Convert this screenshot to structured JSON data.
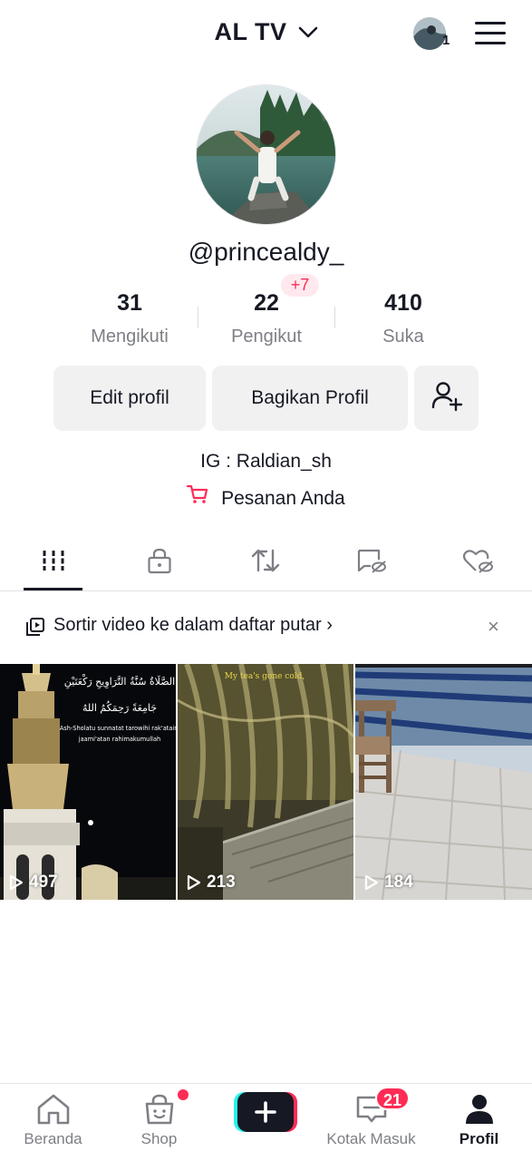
{
  "header": {
    "account_name": "AL TV",
    "switch_badge": "1",
    "icons": {
      "chevron": "chevron-down-icon",
      "menu": "hamburger-menu-icon"
    }
  },
  "profile": {
    "username": "@princealdy_",
    "stats": [
      {
        "value": "31",
        "label": "Mengikuti"
      },
      {
        "value": "22",
        "label": "Pengikut",
        "badge": "+7"
      },
      {
        "value": "410",
        "label": "Suka"
      }
    ],
    "buttons": {
      "edit": "Edit profil",
      "share": "Bagikan Profil"
    },
    "bio": "IG : Raldian_sh",
    "orders": "Pesanan Anda"
  },
  "tabs": [
    {
      "icon": "grid-icon",
      "active": true
    },
    {
      "icon": "lock-icon"
    },
    {
      "icon": "repost-icon"
    },
    {
      "icon": "hidden-tag-icon"
    },
    {
      "icon": "hidden-heart-icon"
    }
  ],
  "playlist_banner": {
    "text": "Sortir video ke dalam daftar putar",
    "chevron": "›",
    "close": "×"
  },
  "videos": [
    {
      "views": "497",
      "caption_line1": "الصَّلَاةُ سُنَّةُ التَّرَاوِيحِ رَكْعَتَيْنِ",
      "caption_line2": "جَامِعَةً رَحِمَكُمُ اللهُ",
      "caption_line3": "Ash-Sholatu sunnatat tarowihi rak'ataini",
      "caption_line4": "jaami'atan rahimakumullah"
    },
    {
      "views": "213",
      "caption": "My tea's gone cold,"
    },
    {
      "views": "184"
    }
  ],
  "bottom_nav": [
    {
      "label": "Beranda",
      "icon": "home-icon"
    },
    {
      "label": "Shop",
      "icon": "shop-bag-icon",
      "dot": true
    },
    {
      "label": "",
      "icon": "create-plus-icon"
    },
    {
      "label": "Kotak Masuk",
      "icon": "inbox-icon",
      "badge": "21"
    },
    {
      "label": "Profil",
      "icon": "profile-icon",
      "active": true
    }
  ],
  "colors": {
    "accent": "#fe2c55",
    "text": "#161823",
    "muted": "#7d7f85",
    "button_bg": "#f1f1f2",
    "cyan": "#25f4ee"
  }
}
